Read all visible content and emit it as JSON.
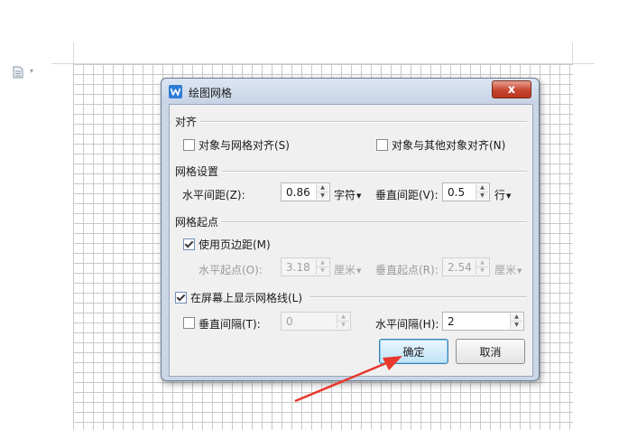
{
  "document": {
    "icon": "document-icon",
    "caret": "▾"
  },
  "dialog": {
    "title": "绘图网格",
    "close_label": "x",
    "align": {
      "title": "对齐",
      "snap_to_grid": {
        "label": "对象与网格对齐(S)",
        "checked": false
      },
      "snap_to_objects": {
        "label": "对象与其他对象对齐(N)",
        "checked": false
      }
    },
    "grid_settings": {
      "title": "网格设置",
      "h_spacing": {
        "label": "水平间距(Z):",
        "value": "0.86",
        "unit": "字符"
      },
      "v_spacing": {
        "label": "垂直间距(V):",
        "value": "0.5",
        "unit": "行"
      }
    },
    "grid_origin": {
      "title": "网格起点",
      "use_margins": {
        "label": "使用页边距(M)",
        "checked": true
      },
      "h_origin": {
        "label": "水平起点(O):",
        "value": "3.18",
        "unit": "厘米"
      },
      "v_origin": {
        "label": "垂直起点(R):",
        "value": "2.54",
        "unit": "厘米"
      }
    },
    "show_gridlines": {
      "label": "在屏幕上显示网格线(L)",
      "checked": true,
      "v_every": {
        "label": "垂直间隔(T):",
        "value": "0",
        "checked": false
      },
      "h_every": {
        "label": "水平间隔(H):",
        "value": "2"
      }
    },
    "buttons": {
      "ok": "确定",
      "cancel": "取消"
    }
  },
  "colors": {
    "accent": "#2f7cd6",
    "close_button": "#c8452f",
    "annotation_arrow": "#e8382c"
  }
}
